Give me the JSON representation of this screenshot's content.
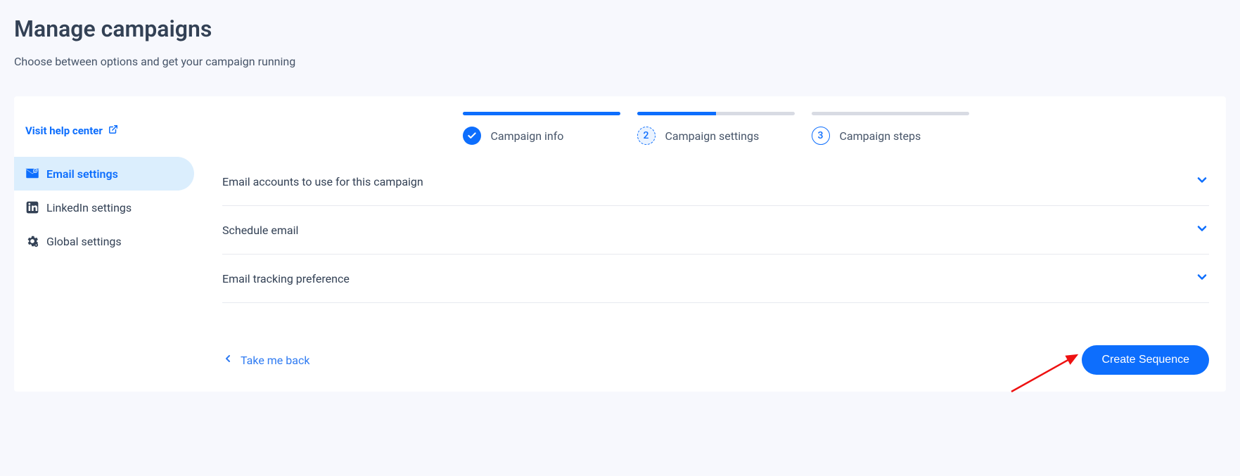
{
  "header": {
    "title": "Manage campaigns",
    "subtitle": "Choose between options and get your campaign running"
  },
  "help": {
    "label": "Visit help center"
  },
  "sidebar": {
    "items": [
      {
        "label": "Email settings"
      },
      {
        "label": "LinkedIn settings"
      },
      {
        "label": "Global settings"
      }
    ]
  },
  "stepper": {
    "steps": [
      {
        "label": "Campaign info"
      },
      {
        "label": "Campaign settings",
        "number": "2"
      },
      {
        "label": "Campaign steps",
        "number": "3"
      }
    ]
  },
  "accordions": [
    {
      "title": "Email accounts to use for this campaign"
    },
    {
      "title": "Schedule email"
    },
    {
      "title": "Email tracking preference"
    }
  ],
  "footer": {
    "back_label": "Take me back",
    "primary_label": "Create Sequence"
  }
}
